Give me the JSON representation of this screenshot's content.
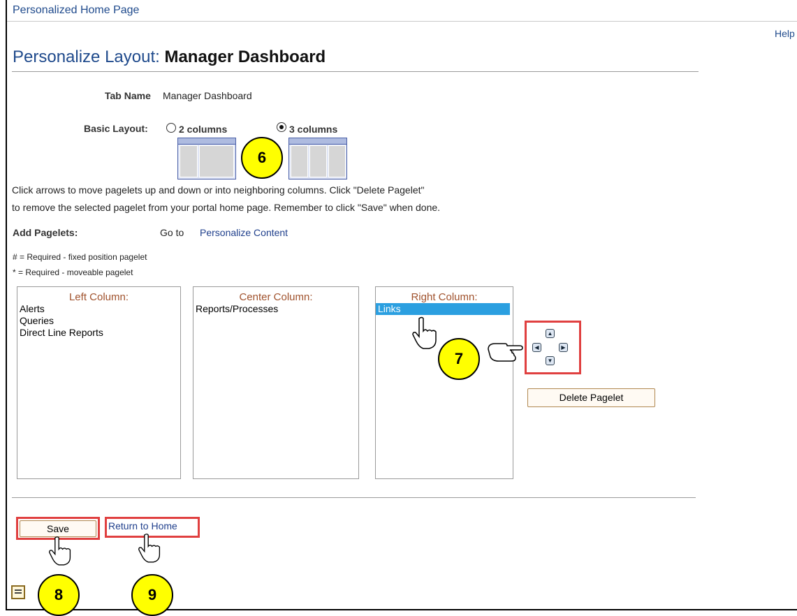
{
  "topbar": {
    "title": "Personalized Home Page",
    "help": "Help"
  },
  "header": {
    "prefix": "Personalize Layout:",
    "name": "Manager Dashboard"
  },
  "tab": {
    "label": "Tab Name",
    "value": "Manager Dashboard"
  },
  "layout": {
    "label": "Basic Layout:",
    "options": [
      {
        "label": "2 columns",
        "selected": false
      },
      {
        "label": "3 columns",
        "selected": true
      }
    ]
  },
  "instructions": {
    "line1": "Click arrows to move pagelets up and down or into neighboring columns. Click \"Delete Pagelet\"",
    "line2": "to remove the selected pagelet from your portal home page. Remember to click \"Save\" when done."
  },
  "add_pagelets": {
    "label": "Add Pagelets:",
    "goto": "Go to",
    "link": "Personalize Content"
  },
  "legend": {
    "fixed": "# = Required - fixed position pagelet",
    "moveable": "* = Required - moveable pagelet"
  },
  "columns": {
    "left": {
      "title": "Left Column:",
      "items": [
        "Alerts",
        "Queries",
        "Direct Line Reports"
      ]
    },
    "center": {
      "title": "Center Column:",
      "items": [
        "Reports/Processes"
      ]
    },
    "right": {
      "title": "Right Column:",
      "items": [
        "Links"
      ],
      "selected": "Links"
    }
  },
  "buttons": {
    "delete": "Delete Pagelet",
    "save": "Save",
    "return": "Return to Home"
  },
  "callouts": {
    "c6": "6",
    "c7": "7",
    "c8": "8",
    "c9": "9"
  },
  "colors": {
    "accent": "#1f4a8c",
    "highlight": "#e04040",
    "callout": "#ffff00",
    "selection": "#2b9fe0"
  },
  "icons": [
    "radio-icon",
    "arrow-up-icon",
    "arrow-down-icon",
    "arrow-left-icon",
    "arrow-right-icon",
    "hand-pointer-icon",
    "page-icon"
  ]
}
